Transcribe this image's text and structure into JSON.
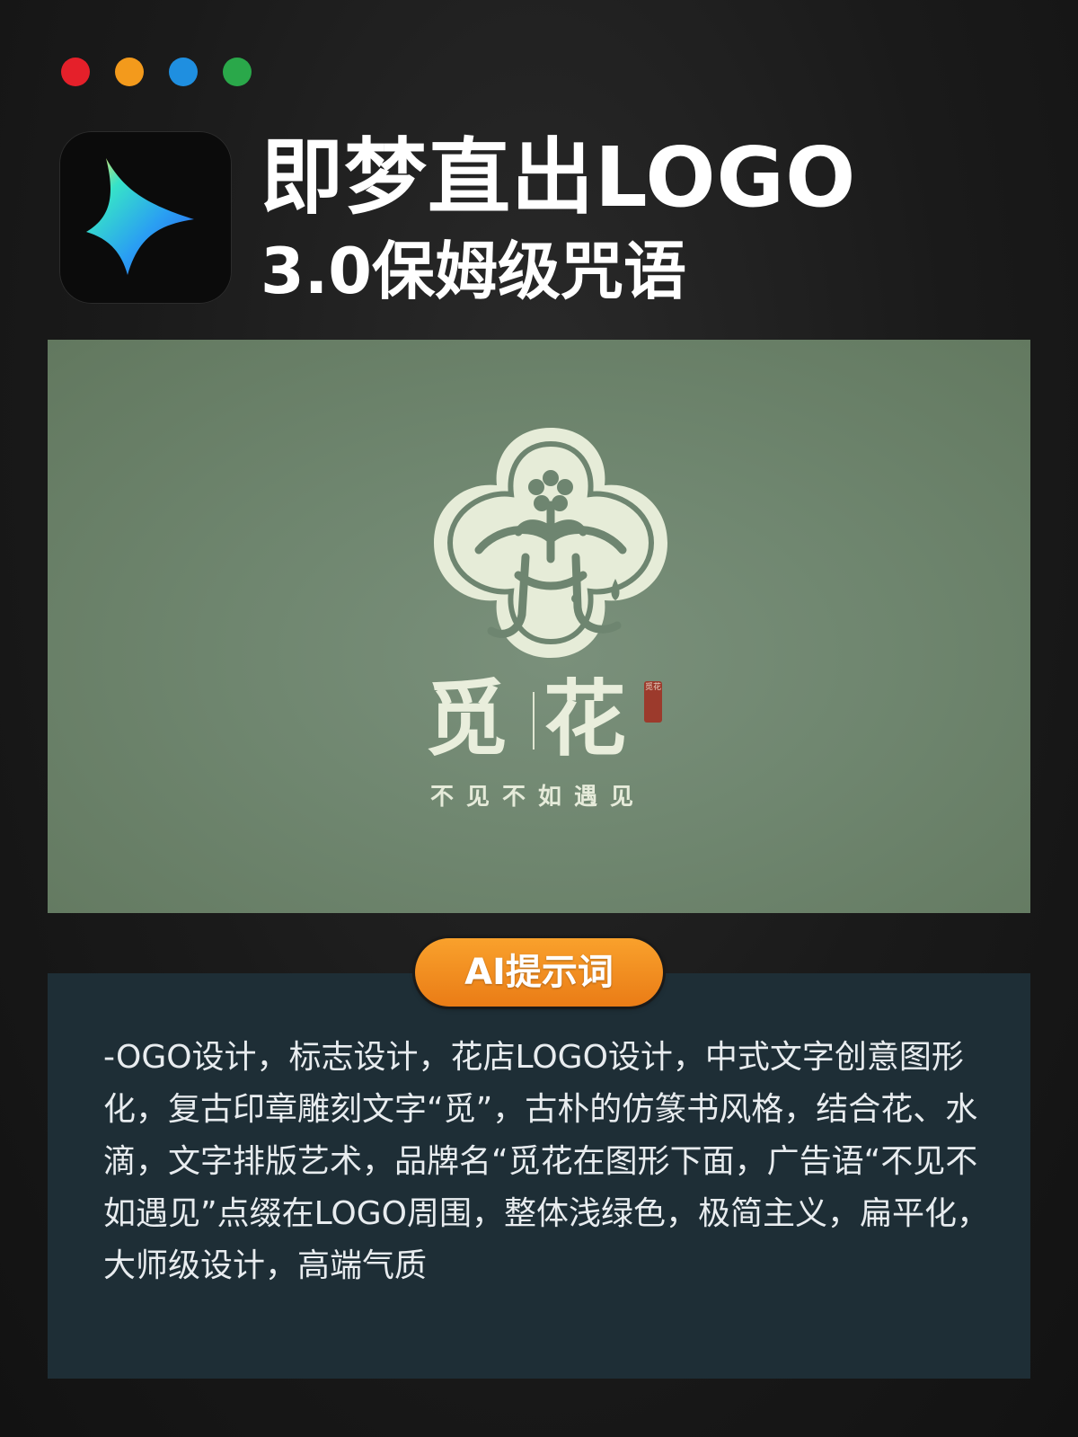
{
  "window_dots": [
    {
      "name": "red",
      "color": "#e5202a"
    },
    {
      "name": "orange",
      "color": "#f39a1c"
    },
    {
      "name": "blue",
      "color": "#1f8fe0"
    },
    {
      "name": "green",
      "color": "#2aa84a"
    }
  ],
  "header": {
    "app_icon": "jimeng-star-icon",
    "title_line1": "即梦直出LOGO",
    "title_line2": "3.0保姆级咒语"
  },
  "preview": {
    "background_color": "#6e8570",
    "emblem_icon": "flower-seal-emblem-icon",
    "brand_left": "觅",
    "brand_right": "花",
    "seal_text": "觅花",
    "slogan": "不见不如遇见"
  },
  "prompt": {
    "badge": "AI提示词",
    "text": "-OGO设计，标志设计，花店LOGO设计，中式文字创意图形化，复古印章雕刻文字“觅”，古朴的仿篆书风格，结合花、水滴，文字排版艺术，品牌名“觅花在图形下面，广告语“不见不如遇见”点缀在LOGO周围，整体浅绿色，极简主义，扁平化，大师级设计，高端气质"
  }
}
